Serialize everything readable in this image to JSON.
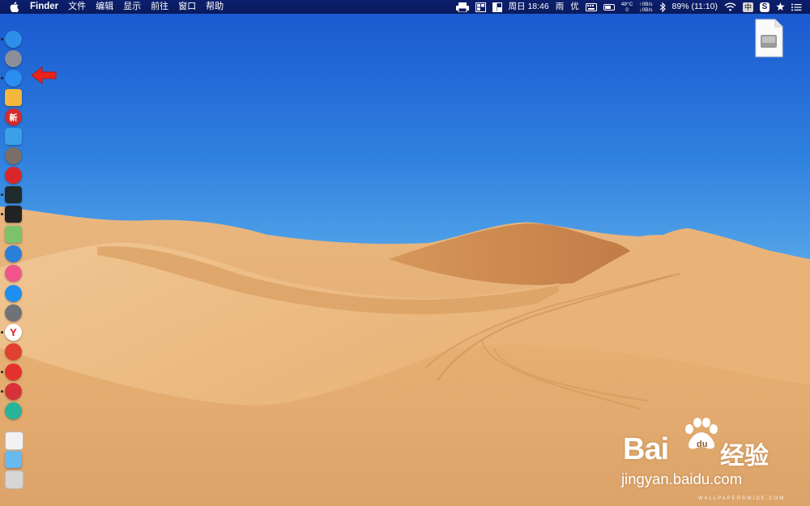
{
  "menubar": {
    "app_name": "Finder",
    "menus": [
      "文件",
      "编辑",
      "显示",
      "前往",
      "窗口",
      "帮助"
    ],
    "status": {
      "datetime": "周日 18:46",
      "weather": "雨",
      "optimize": "优",
      "cpu_temp": "48°C",
      "fan": "0",
      "net_up": "↑0B/s",
      "net_down": "↓0B/s",
      "battery": "89% (11:10)",
      "input_method": "中",
      "sogou": "S"
    }
  },
  "dock": {
    "apps": [
      {
        "id": "finder-icon",
        "color": "#2f8fe8"
      },
      {
        "id": "launchpad-icon",
        "color": "#8a8f99"
      },
      {
        "id": "safari-icon",
        "color": "#2a8ef0"
      },
      {
        "id": "preview-icon",
        "color": "#f4b63c"
      },
      {
        "id": "news-icon",
        "color": "#d52a2a",
        "glyph": "新"
      },
      {
        "id": "screen-share-icon",
        "color": "#3aa0e8"
      },
      {
        "id": "photo-browser-icon",
        "color": "#7a6e66"
      },
      {
        "id": "netease-icon",
        "color": "#d8262b"
      },
      {
        "id": "activity-monitor-icon",
        "color": "#1f2b2d"
      },
      {
        "id": "terminal-icon",
        "color": "#222222"
      },
      {
        "id": "maps-icon",
        "color": "#7cc26b"
      },
      {
        "id": "siri-icon",
        "color": "#2a7fd8"
      },
      {
        "id": "itunes-icon",
        "color": "#f0548a"
      },
      {
        "id": "app-store-icon",
        "color": "#1e8ef2"
      },
      {
        "id": "system-preferences-icon",
        "color": "#6f7378"
      },
      {
        "id": "yandex-icon",
        "color": "#ffffff"
      },
      {
        "id": "chrome-icon",
        "color": "#e0402f"
      },
      {
        "id": "netease-music-icon",
        "color": "#e3322d"
      },
      {
        "id": "vivaldi-icon",
        "color": "#d8313a"
      },
      {
        "id": "cleanmaster-icon",
        "color": "#27b49a"
      },
      {
        "id": "document-icon",
        "color": "#f2f2f2"
      },
      {
        "id": "folder-icon",
        "color": "#6ab8f0"
      },
      {
        "id": "trash-icon",
        "color": "#d6d6d6"
      }
    ]
  },
  "watermark": {
    "brand": "Bai",
    "brand_cn": "经验",
    "url": "jingyan.baidu.com",
    "credit": "WALLPAPERSWIDE.COM"
  },
  "colors": {
    "menubar": "#0a1a5c",
    "arrow": "#e8231c"
  }
}
